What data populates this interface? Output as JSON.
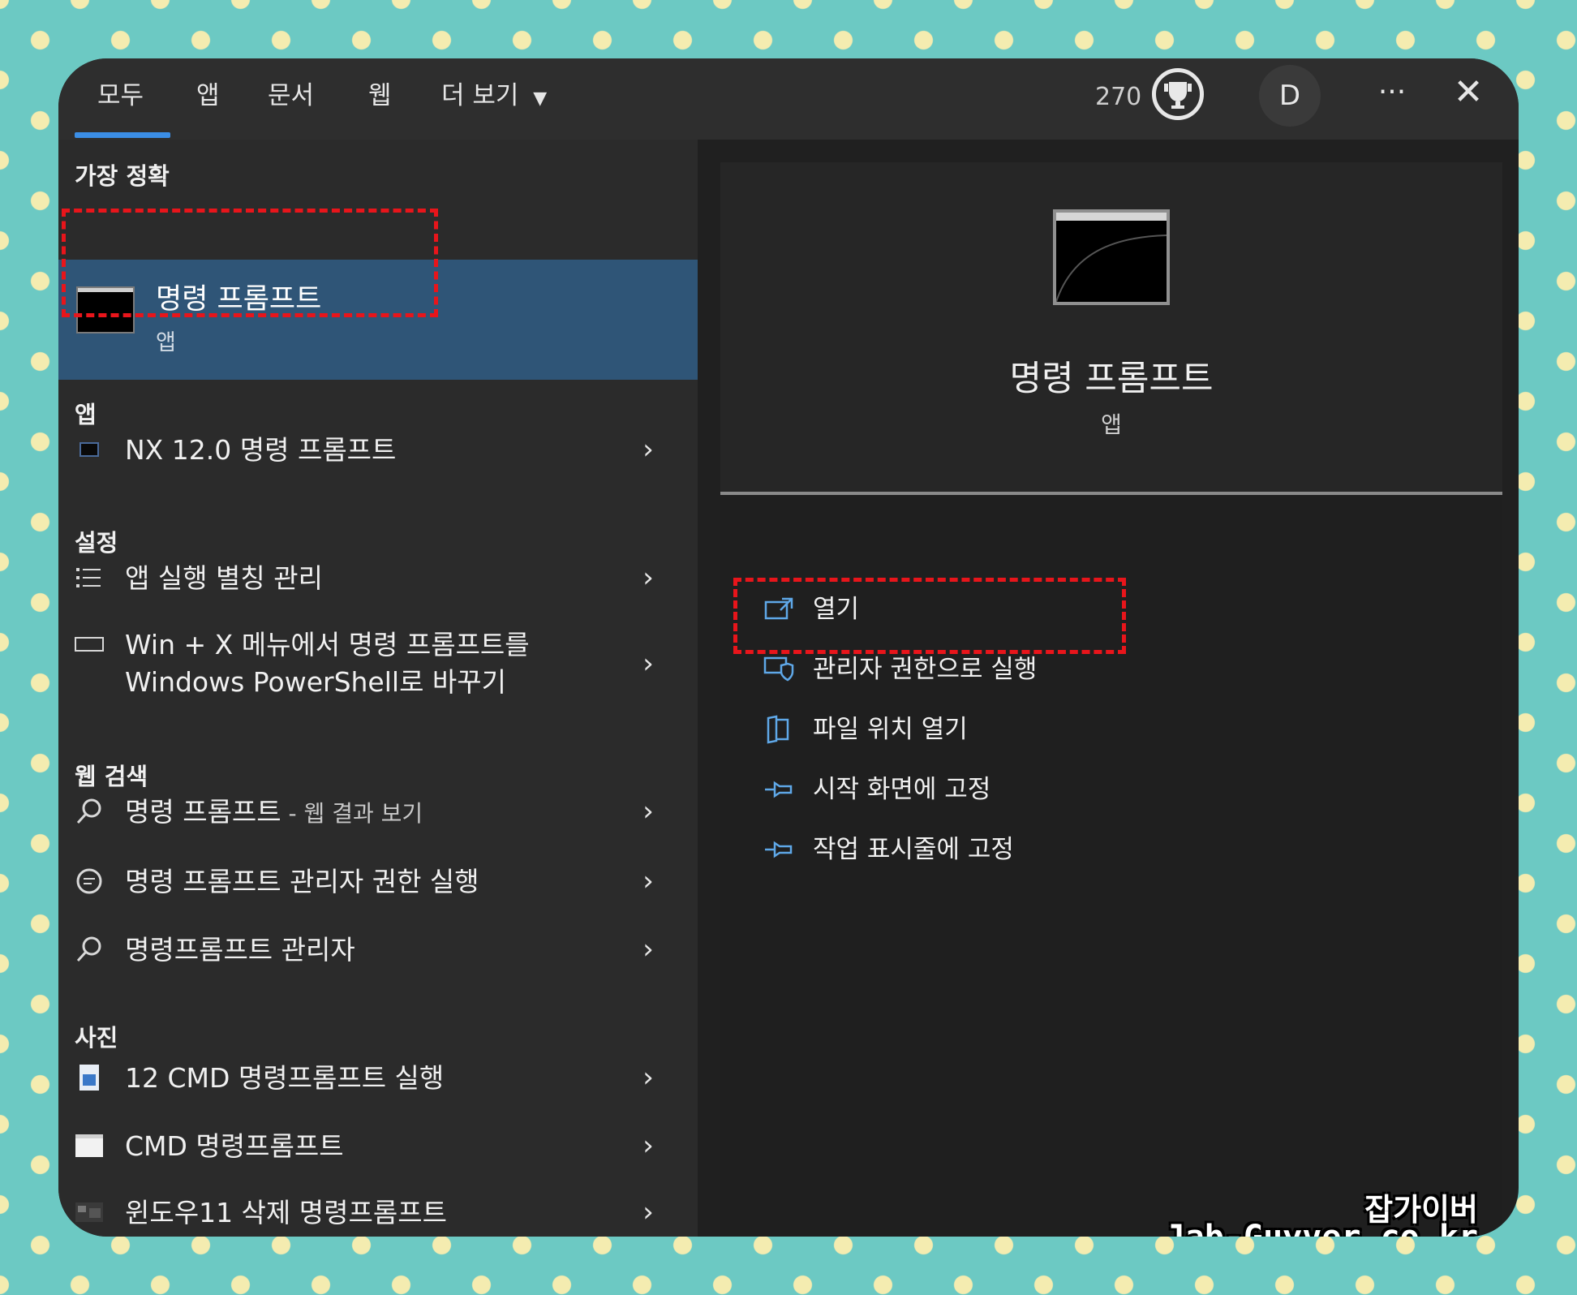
{
  "tabs": [
    "모두",
    "앱",
    "문서",
    "웹",
    "더 보기"
  ],
  "topbar": {
    "points": "270",
    "avatar_letter": "D",
    "more_glyph": "···",
    "close_glyph": "✕"
  },
  "left": {
    "best_section": "가장 정확",
    "best": {
      "title": "명령 프롬프트",
      "subtitle": "앱"
    },
    "apps_section": "앱",
    "apps": [
      {
        "label": "NX 12.0 명령 프롬프트"
      }
    ],
    "settings_section": "설정",
    "settings": [
      {
        "label": "앱 실행 별칭 관리"
      },
      {
        "line1": "Win + X 메뉴에서 명령 프롬프트를",
        "line2": "Windows PowerShell로 바꾸기"
      }
    ],
    "web_section": "웹 검색",
    "web": [
      {
        "label": "명령 프롬프트",
        "suffix": " - 웹 결과 보기"
      },
      {
        "label": "명령 프롬프트 관리자 권한 실행"
      },
      {
        "label": "명령프롬프트 관리자"
      }
    ],
    "photos_section": "사진",
    "photos": [
      {
        "label": "12 CMD 명령프롬프트 실행"
      },
      {
        "label": "CMD 명령프롬프트"
      },
      {
        "label": "윈도우11 삭제 명령프롬프트"
      }
    ]
  },
  "right": {
    "title": "명령 프롬프트",
    "subtitle": "앱",
    "actions": [
      {
        "label": "열기",
        "icon": "open-icon"
      },
      {
        "label": "관리자 권한으로 실행",
        "icon": "shield-icon"
      },
      {
        "label": "파일 위치 열기",
        "icon": "folder-icon"
      },
      {
        "label": "시작 화면에 고정",
        "icon": "pin-icon"
      },
      {
        "label": "작업 표시줄에 고정",
        "icon": "pin-icon"
      }
    ]
  },
  "watermark": {
    "line1": "잡가이버",
    "line2": "Jab-Guyver.co.kr"
  },
  "colors": {
    "accent": "#3b8ee6",
    "highlight": "#2f5577",
    "annotation": "#e8151b",
    "background": "#6cc9c3"
  }
}
